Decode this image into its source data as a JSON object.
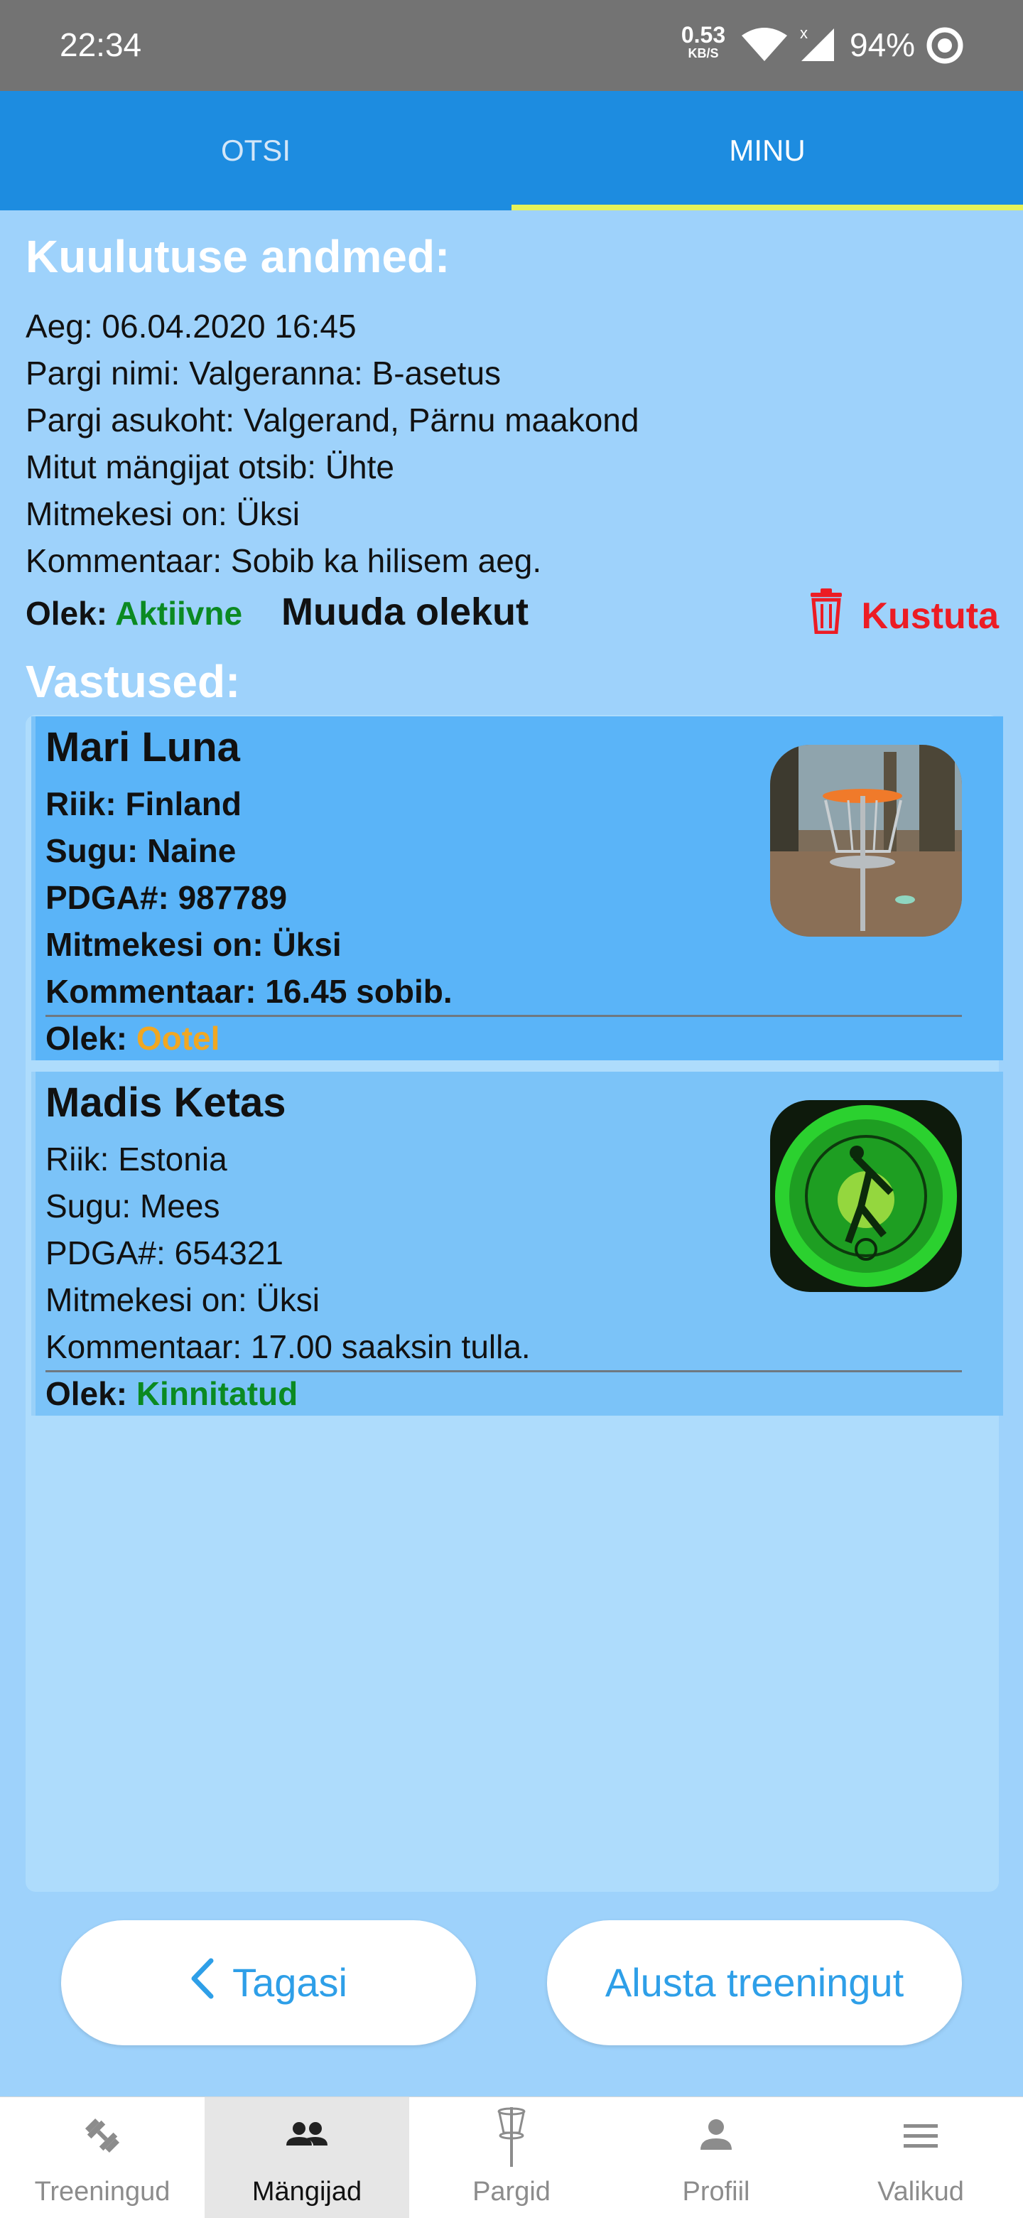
{
  "status_bar": {
    "time": "22:34",
    "net_speed_value": "0.53",
    "net_speed_unit": "KB/S",
    "battery_percent": "94%"
  },
  "tabs": [
    {
      "label": "OTSI",
      "active": false
    },
    {
      "label": "MINU",
      "active": true
    }
  ],
  "listing": {
    "heading": "Kuulutuse andmed:",
    "lines": [
      "Aeg: 06.04.2020 16:45",
      "Pargi nimi: Valgeranna: B-asetus",
      "Pargi asukoht: Valgerand, Pärnu maakond",
      "Mitut mängijat otsib: Ühte",
      "Mitmekesi on: Üksi",
      "Kommentaar: Sobib ka hilisem aeg."
    ],
    "state_label": "Olek:",
    "state_value": "Aktiivne",
    "change_state_label": "Muuda olekut",
    "delete_label": "Kustuta"
  },
  "responses": {
    "heading": "Vastused:",
    "items": [
      {
        "name": "Mari Luna",
        "country": "Riik: Finland",
        "gender": "Sugu: Naine",
        "pdga": "PDGA#: 987789",
        "group": "Mitmekesi on: Üksi",
        "comment": "Kommentaar: 16.45 sobib.",
        "state_label": "Olek:",
        "state_value": "Ootel"
      },
      {
        "name": "Madis Ketas",
        "country": "Riik: Estonia",
        "gender": "Sugu: Mees",
        "pdga": "PDGA#: 654321",
        "group": "Mitmekesi on: Üksi",
        "comment": "Kommentaar: 17.00 saaksin tulla.",
        "state_label": "Olek:",
        "state_value": "Kinnitatud"
      }
    ]
  },
  "actions": {
    "back_label": "Tagasi",
    "start_label": "Alusta treeningut"
  },
  "bottom_nav": [
    {
      "label": "Treeningud",
      "icon": "dumbbell-icon",
      "active": false
    },
    {
      "label": "Mängijad",
      "icon": "people-icon",
      "active": true
    },
    {
      "label": "Pargid",
      "icon": "disc-golf-basket-icon",
      "active": false
    },
    {
      "label": "Profiil",
      "icon": "person-icon",
      "active": false
    },
    {
      "label": "Valikud",
      "icon": "menu-icon",
      "active": false
    }
  ],
  "colors": {
    "tab_bar": "#1d8ce0",
    "tab_indicator": "#e6f25a",
    "page_bg": "#9ed2fb",
    "active_green": "#0b8a22",
    "pending_orange": "#f1a722",
    "delete_red": "#ec1c24",
    "button_text": "#2e9fe8"
  }
}
